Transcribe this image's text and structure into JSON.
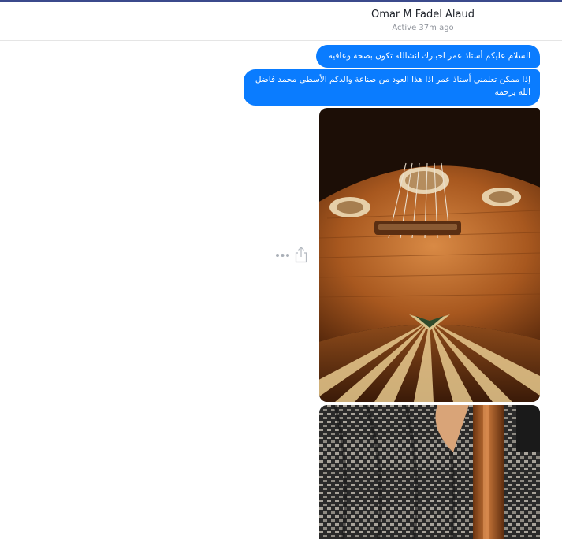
{
  "header": {
    "contact_name": "Omar M Fadel Alaud",
    "status": "Active 37m ago"
  },
  "messages": [
    {
      "type": "text",
      "direction": "outgoing",
      "text": "السلام عليكم أستاذ عمر اخبارك انشالله تكون بصحة وعافيه"
    },
    {
      "type": "text",
      "direction": "outgoing",
      "text": "إذا ممكن تعلمني أستاذ عمر اذا هذا العود من صناعة والدكم الأسطى محمد فاضل الله يرحمه"
    },
    {
      "type": "image",
      "direction": "outgoing",
      "subject": "oud-soundboard-photo"
    },
    {
      "type": "image",
      "direction": "outgoing",
      "subject": "oud-neck-fabric-photo"
    }
  ],
  "message_actions": {
    "icons": [
      "more-icon",
      "share-icon"
    ]
  },
  "colors": {
    "bubble": "#0a7cff",
    "bubble_text": "#ffffff",
    "top_line": "#3b4a8c",
    "name_text": "#1d2129",
    "status_text": "#90949c"
  }
}
